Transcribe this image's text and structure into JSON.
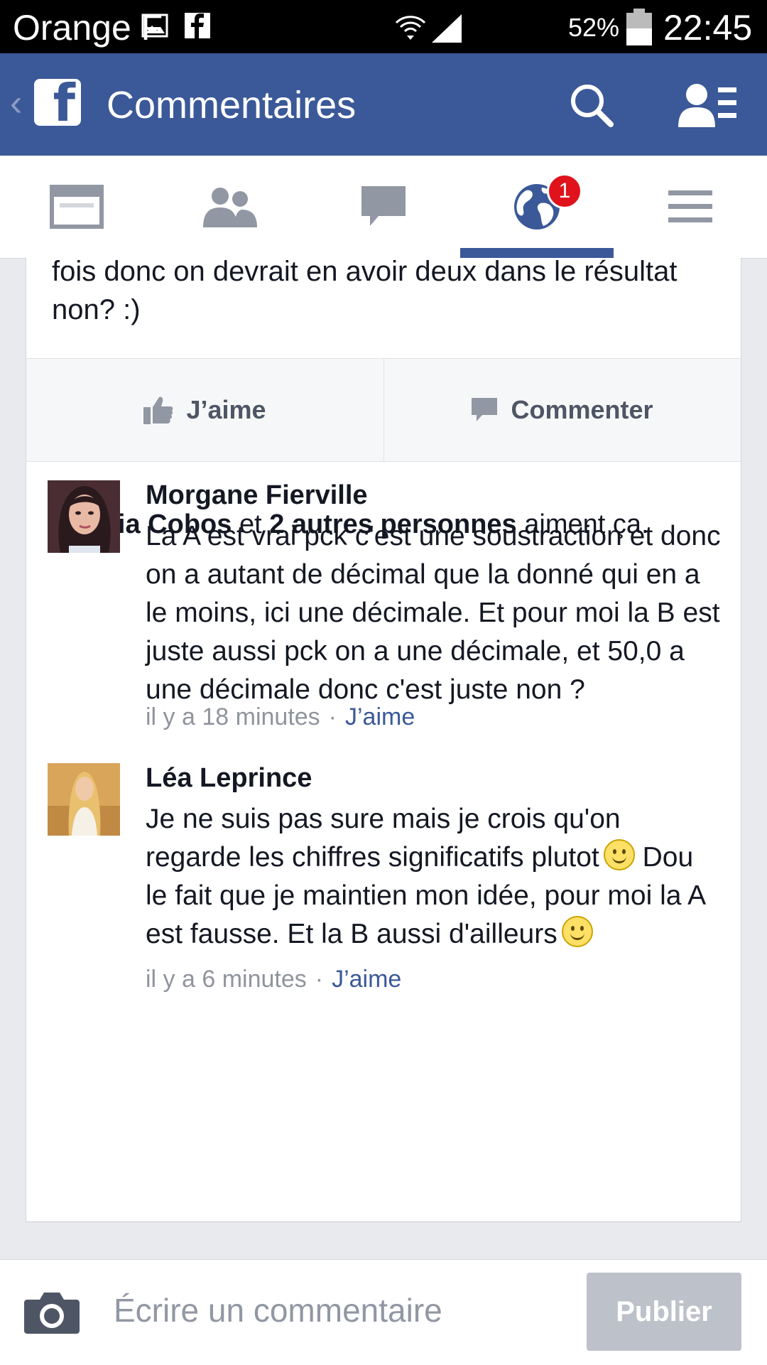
{
  "status_bar": {
    "carrier": "Orange F",
    "battery": "52%",
    "time": "22:45",
    "icons": [
      "image-icon",
      "facebook-icon",
      "wifi-icon",
      "signal-icon",
      "battery-icon"
    ]
  },
  "header": {
    "title": "Commentaires",
    "icons": [
      "back-chevron-icon",
      "facebook-logo-icon",
      "search-icon",
      "friend-requests-icon"
    ],
    "brand_color": "#3b5998"
  },
  "tabs": {
    "items": [
      {
        "name": "news-feed",
        "icon": "newsfeed-icon"
      },
      {
        "name": "friend-requests",
        "icon": "friends-icon"
      },
      {
        "name": "messages",
        "icon": "chat-bubble-icon"
      },
      {
        "name": "notifications",
        "icon": "globe-icon",
        "active": true,
        "badge": "1"
      },
      {
        "name": "more",
        "icon": "menu-icon"
      }
    ],
    "badge_color": "#e0121b"
  },
  "post": {
    "text_tail": "fois donc on devrait en avoir deux dans le résultat non? :)",
    "like_label": "J’aime",
    "comment_label": "Commenter",
    "likes_summary": {
      "name": "Amalia Cobos",
      "connector": " et ",
      "others": "2 autres personnes",
      "suffix": " aiment ça."
    }
  },
  "comments": [
    {
      "author": "Morgane Fierville",
      "text": "La A est vrai pck c'est une soustraction et donc on a autant de décimal que la donné qui en a le moins, ici une décimale. Et pour moi la B est juste aussi pck on a une décimale, et 50,0 a une décimale donc c'est juste non ?",
      "time": "il y a 18 minutes",
      "like_label": "J’aime"
    },
    {
      "author": "Léa Leprince",
      "text_part1": "Je ne suis pas sure mais je crois qu'on regarde les chiffres significatifs plutot",
      "text_part2": "Dou le fait que je maintien mon idée, pour moi la A est fausse. Et la B aussi d'ailleurs",
      "time": "il y a 6 minutes",
      "like_label": "J’aime",
      "emoji": "smiley-icon"
    }
  ],
  "composer": {
    "placeholder": "Écrire un commentaire",
    "publish_label": "Publier",
    "icon": "camera-icon"
  }
}
